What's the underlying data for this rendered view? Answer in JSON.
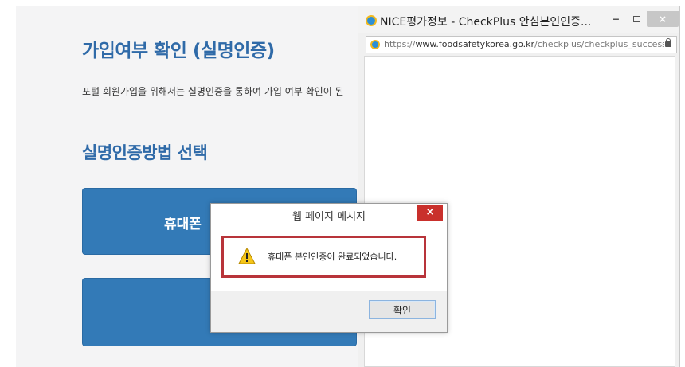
{
  "background_page": {
    "title": "가입여부 확인 (실명인증)",
    "description": "포털 회원가입을 위해서는 실명인증을 통하여 가입 여부 확인이 된",
    "section_title": "실명인증방법 선택",
    "phone_button_label": "휴대폰"
  },
  "popup": {
    "title": "NICE평가정보 - CheckPlus 안심본인인증...",
    "minimize": "−",
    "close": "×",
    "url_prefix": "https://",
    "url_domain": "www.foodsafetykorea.go.kr",
    "url_path": "/checkplus/checkplus_success.jsp"
  },
  "dialog": {
    "title": "웹 페이지 메시지",
    "close": "×",
    "message": "휴대폰 본인인증이 완료되었습니다.",
    "ok_label": "확인"
  },
  "colors": {
    "accent": "#2f6aa8",
    "button": "#337ab7",
    "highlight": "#b8343a",
    "close_red": "#c9302c"
  }
}
